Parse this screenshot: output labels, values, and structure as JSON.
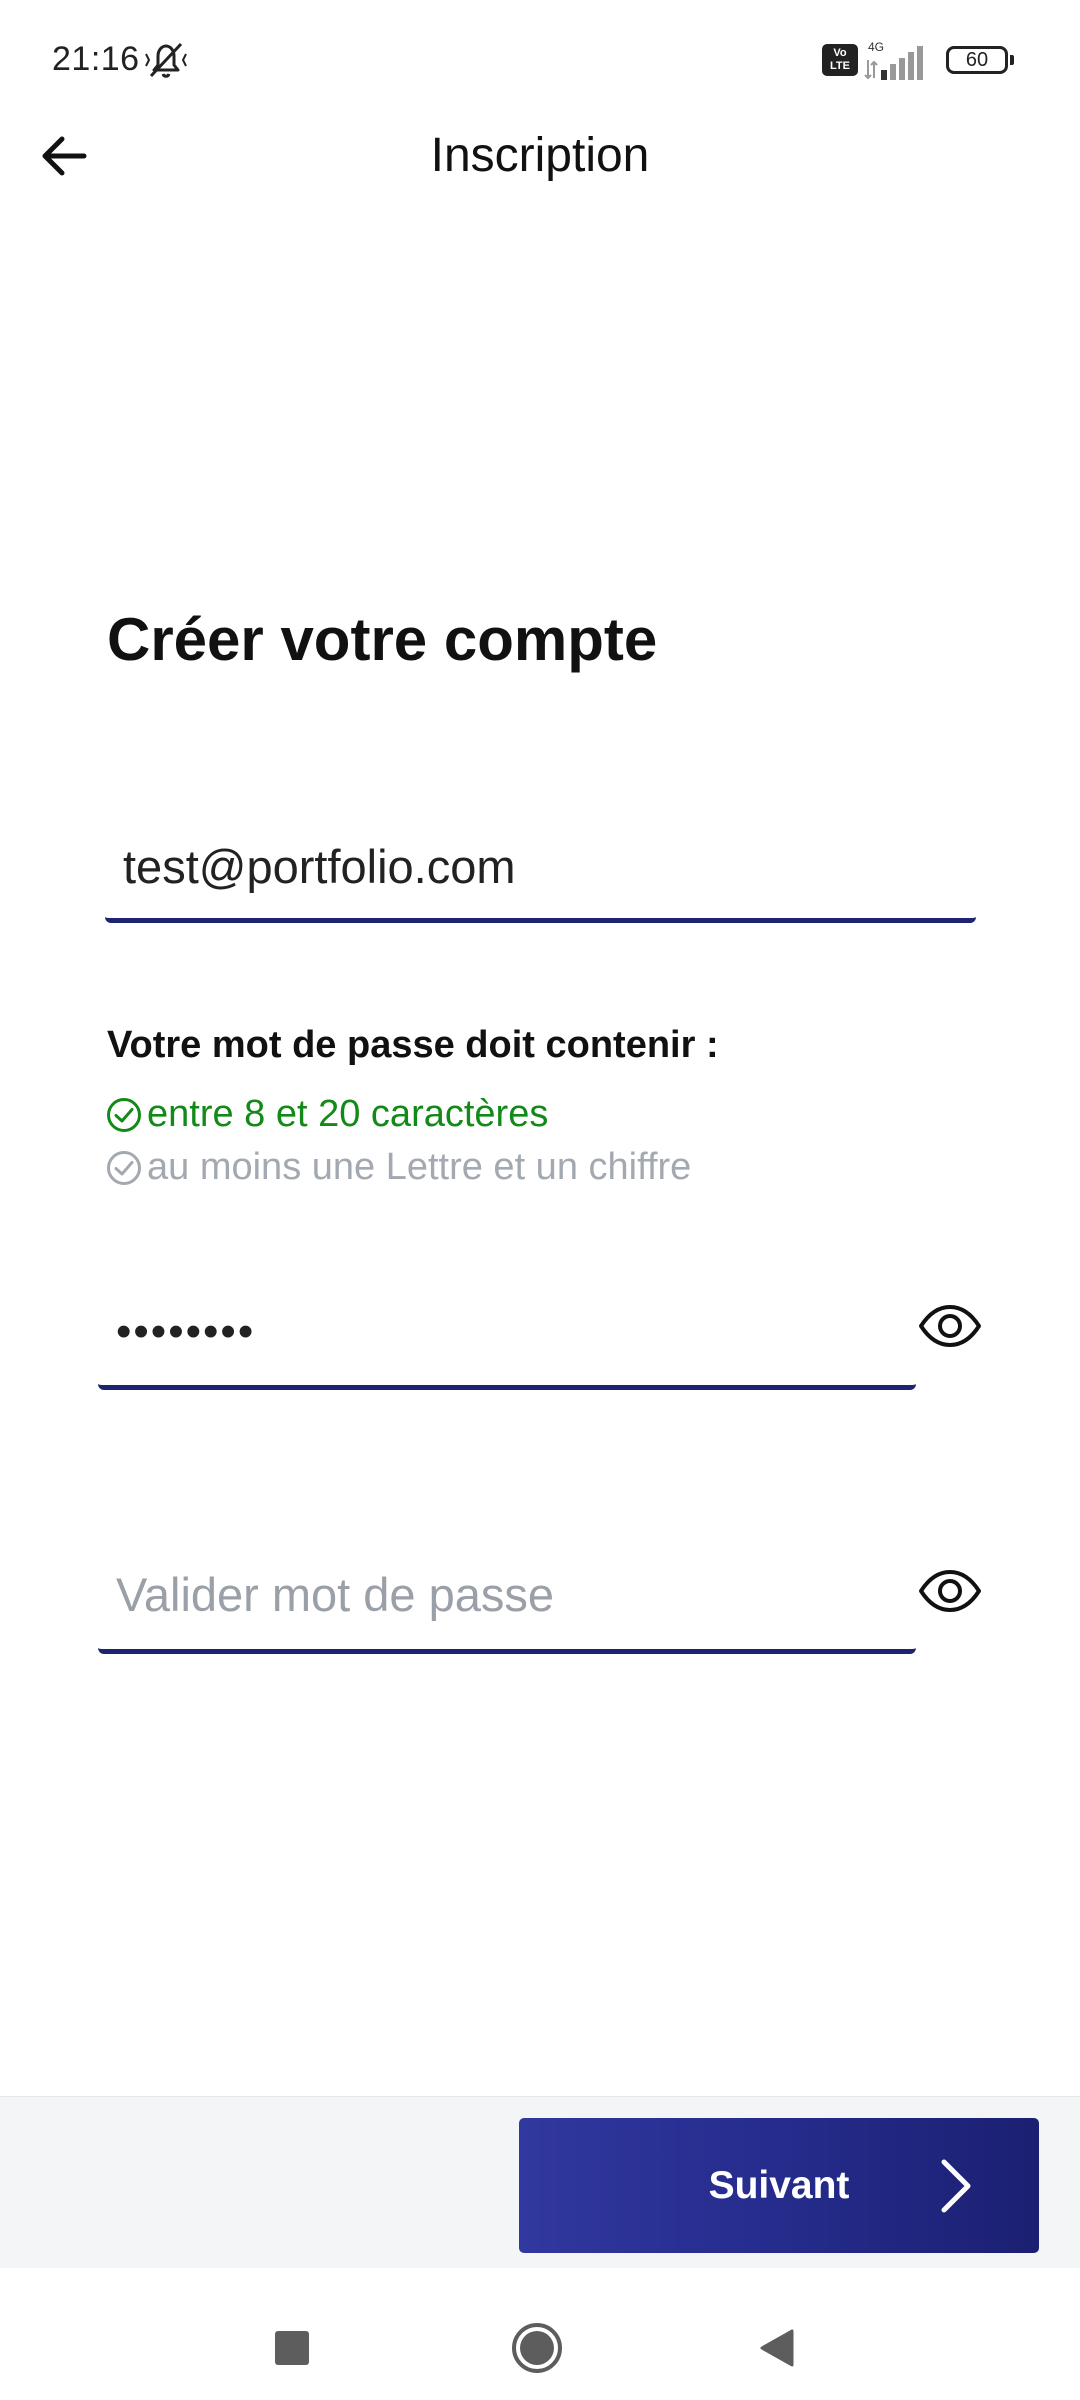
{
  "status_bar": {
    "time": "21:16",
    "network": "4G",
    "volte": "Vo LTE",
    "battery": "60"
  },
  "header": {
    "title": "Inscription",
    "back_icon": "arrow-left-icon"
  },
  "form": {
    "heading": "Créer votre compte",
    "email": {
      "value": "test@portfolio.com",
      "placeholder": ""
    },
    "password_rules": {
      "title": "Votre mot de passe doit contenir :",
      "rules": [
        {
          "label": "entre 8 et 20 caractères",
          "satisfied": true,
          "color": "#138a18"
        },
        {
          "label": "au moins une Lettre et un chiffre",
          "satisfied": false,
          "color": "#a3a9b1"
        }
      ]
    },
    "password": {
      "value": "12345678",
      "visibility_icon": "eye-icon"
    },
    "confirm_password": {
      "value": "",
      "placeholder": "Valider mot de passe",
      "visibility_icon": "eye-icon"
    }
  },
  "footer": {
    "next_label": "Suivant",
    "next_icon": "chevron-right-icon",
    "accent_color": "#262d8e"
  },
  "navigation_bar": {
    "icons": [
      "recents-square-icon",
      "home-circle-icon",
      "back-triangle-icon"
    ]
  }
}
